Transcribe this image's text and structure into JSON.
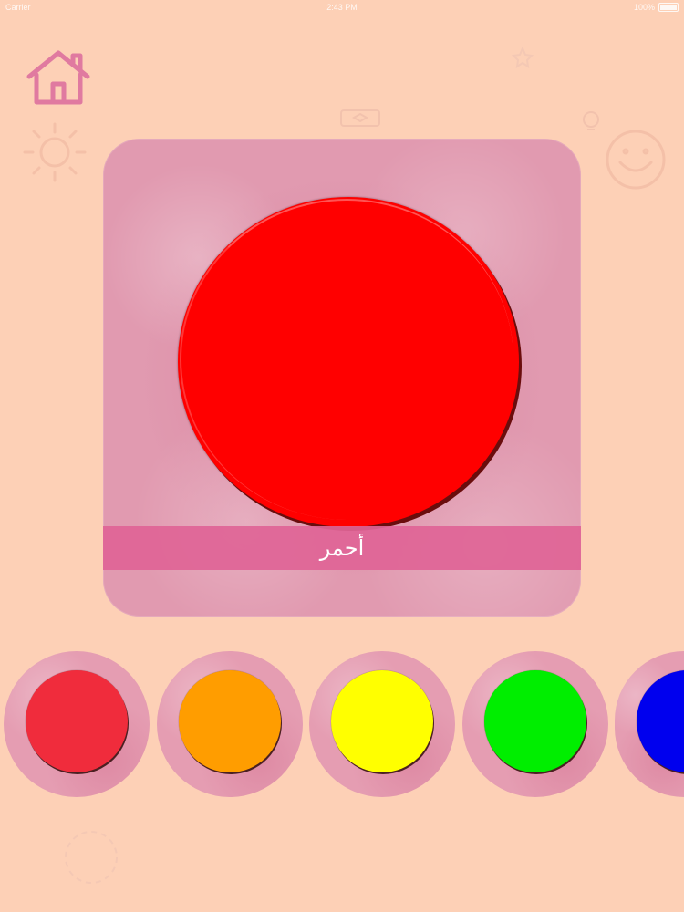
{
  "status_bar": {
    "carrier": "Carrier",
    "time": "2:43 PM",
    "battery": "100%"
  },
  "home": {
    "icon": "home-icon",
    "color": "#e07aa0"
  },
  "card": {
    "selected_color_hex": "#ff0000",
    "label": "أحمر"
  },
  "palette": {
    "swatches": [
      {
        "name": "red",
        "hex": "#f02c3c"
      },
      {
        "name": "orange",
        "hex": "#ff9d00"
      },
      {
        "name": "yellow",
        "hex": "#ffff00"
      },
      {
        "name": "green",
        "hex": "#00ee00"
      },
      {
        "name": "blue",
        "hex": "#0000ee"
      }
    ]
  }
}
